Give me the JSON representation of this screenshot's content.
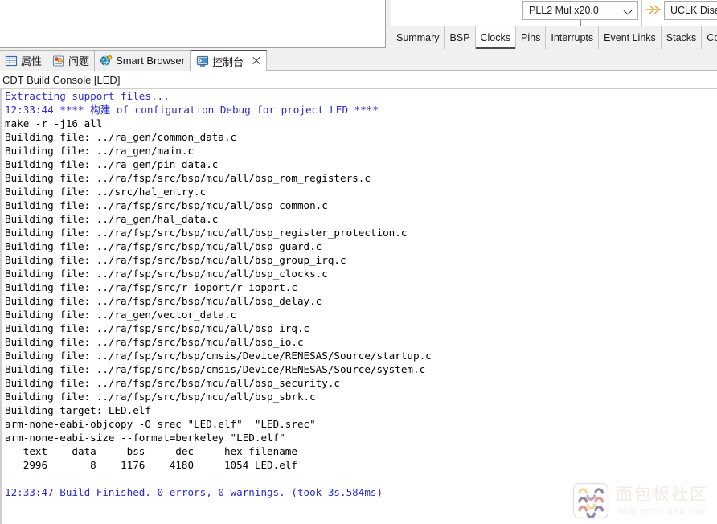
{
  "editor": {
    "pll_combo": {
      "value": "PLL2 Mul x20.0",
      "chevron_icon": "chevron-down-icon"
    },
    "uclk_box": {
      "value": "UCLK Disabl",
      "arrow_icon": "flow-arrow-icon"
    },
    "config_tabs": [
      {
        "label": "Summary",
        "active": false
      },
      {
        "label": "BSP",
        "active": false
      },
      {
        "label": "Clocks",
        "active": true
      },
      {
        "label": "Pins",
        "active": false
      },
      {
        "label": "Interrupts",
        "active": false
      },
      {
        "label": "Event Links",
        "active": false
      },
      {
        "label": "Stacks",
        "active": false
      },
      {
        "label": "Compone",
        "active": false
      }
    ]
  },
  "view_tabs": [
    {
      "label": "属性",
      "icon": "properties-table-icon",
      "active": false,
      "closable": false
    },
    {
      "label": "问题",
      "icon": "problems-warning-icon",
      "active": false,
      "closable": false
    },
    {
      "label": "Smart Browser",
      "icon": "globe-icon",
      "active": false,
      "closable": false
    },
    {
      "label": "控制台",
      "icon": "console-monitor-icon",
      "active": true,
      "closable": true
    }
  ],
  "console": {
    "title": "CDT Build Console [LED]",
    "lines": [
      {
        "text": "Extracting support files...",
        "color": "blue"
      },
      {
        "text": "12:33:44 **** 构建 of configuration Debug for project LED ****",
        "color": "blue"
      },
      {
        "text": "make -r -j16 all",
        "color": "black"
      },
      {
        "text": "Building file: ../ra_gen/common_data.c",
        "color": "black"
      },
      {
        "text": "Building file: ../ra_gen/main.c",
        "color": "black"
      },
      {
        "text": "Building file: ../ra_gen/pin_data.c",
        "color": "black"
      },
      {
        "text": "Building file: ../ra/fsp/src/bsp/mcu/all/bsp_rom_registers.c",
        "color": "black"
      },
      {
        "text": "Building file: ../src/hal_entry.c",
        "color": "black"
      },
      {
        "text": "Building file: ../ra/fsp/src/bsp/mcu/all/bsp_common.c",
        "color": "black"
      },
      {
        "text": "Building file: ../ra_gen/hal_data.c",
        "color": "black"
      },
      {
        "text": "Building file: ../ra/fsp/src/bsp/mcu/all/bsp_register_protection.c",
        "color": "black"
      },
      {
        "text": "Building file: ../ra/fsp/src/bsp/mcu/all/bsp_guard.c",
        "color": "black"
      },
      {
        "text": "Building file: ../ra/fsp/src/bsp/mcu/all/bsp_group_irq.c",
        "color": "black"
      },
      {
        "text": "Building file: ../ra/fsp/src/bsp/mcu/all/bsp_clocks.c",
        "color": "black"
      },
      {
        "text": "Building file: ../ra/fsp/src/r_ioport/r_ioport.c",
        "color": "black"
      },
      {
        "text": "Building file: ../ra/fsp/src/bsp/mcu/all/bsp_delay.c",
        "color": "black"
      },
      {
        "text": "Building file: ../ra_gen/vector_data.c",
        "color": "black"
      },
      {
        "text": "Building file: ../ra/fsp/src/bsp/mcu/all/bsp_irq.c",
        "color": "black"
      },
      {
        "text": "Building file: ../ra/fsp/src/bsp/mcu/all/bsp_io.c",
        "color": "black"
      },
      {
        "text": "Building file: ../ra/fsp/src/bsp/cmsis/Device/RENESAS/Source/startup.c",
        "color": "black"
      },
      {
        "text": "Building file: ../ra/fsp/src/bsp/cmsis/Device/RENESAS/Source/system.c",
        "color": "black"
      },
      {
        "text": "Building file: ../ra/fsp/src/bsp/mcu/all/bsp_security.c",
        "color": "black"
      },
      {
        "text": "Building file: ../ra/fsp/src/bsp/mcu/all/bsp_sbrk.c",
        "color": "black"
      },
      {
        "text": "Building target: LED.elf",
        "color": "black"
      },
      {
        "text": "arm-none-eabi-objcopy -O srec \"LED.elf\"  \"LED.srec\"",
        "color": "black"
      },
      {
        "text": "arm-none-eabi-size --format=berkeley \"LED.elf\"",
        "color": "black"
      },
      {
        "text": "   text    data     bss     dec     hex filename",
        "color": "black"
      },
      {
        "text": "   2996       8    1176    4180     1054 LED.elf",
        "color": "black"
      },
      {
        "text": "",
        "color": "black"
      },
      {
        "text": "12:33:47 Build Finished. 0 errors, 0 warnings. (took 3s.584ms)",
        "color": "blue"
      }
    ],
    "size_table": {
      "headers": [
        "text",
        "data",
        "bss",
        "dec",
        "hex",
        "filename"
      ],
      "row": [
        "2996",
        "8",
        "1176",
        "4180",
        "1054",
        "LED.elf"
      ]
    },
    "build_result": {
      "time": "12:33:47",
      "status": "Build Finished.",
      "errors": 0,
      "warnings": 0,
      "duration": "3s.584ms"
    },
    "build_start": {
      "time": "12:33:44",
      "action": "构建",
      "configuration": "Debug",
      "project": "LED"
    }
  },
  "watermark": {
    "cn": "面包板社区",
    "en": "mbb.eet-china.com",
    "logo_icon": "breadboard-community-logo-icon"
  },
  "colors": {
    "console_blue": "#2a2ad0",
    "console_black": "#000000",
    "accent_orange": "#e8a33d",
    "tab_active_border": "#4d4d4d",
    "panel_bg": "#f0f0f0"
  }
}
